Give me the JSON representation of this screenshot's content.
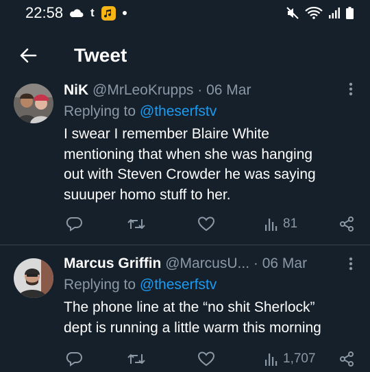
{
  "status_bar": {
    "time": "22:58",
    "app_letter": "t"
  },
  "header": {
    "title": "Tweet"
  },
  "tweets": [
    {
      "name": "NiK",
      "handle": "@MrLeoKrupps",
      "sep": "·",
      "date": "06 Mar",
      "replying_prefix": "Replying to",
      "replying_handle": "@theserfstv",
      "lines": [
        "I swear I remember Blaire White",
        "mentioning that when she was hanging",
        "out with Steven Crowder he was saying",
        "suuuper homo stuff to her."
      ],
      "views": "81"
    },
    {
      "name": "Marcus Griffin",
      "handle": "@MarcusU...",
      "sep": "·",
      "date": "06 Mar",
      "replying_prefix": "Replying to",
      "replying_handle": "@theserfstv",
      "lines": [
        "The phone line at the “no shit Sherlock”",
        "dept is running a little warm this morning"
      ],
      "views": "1,707"
    }
  ],
  "colors": {
    "background": "#15202b",
    "secondary_text": "#8b98a5",
    "link": "#1d9bf0",
    "divider": "#38444d"
  },
  "icons": [
    "cloud-icon",
    "music-app-icon",
    "mute-icon",
    "wifi-icon",
    "signal-icon",
    "battery-icon",
    "back-arrow-icon",
    "more-vertical-icon",
    "reply-icon",
    "retweet-icon",
    "like-icon",
    "views-icon",
    "share-icon"
  ]
}
